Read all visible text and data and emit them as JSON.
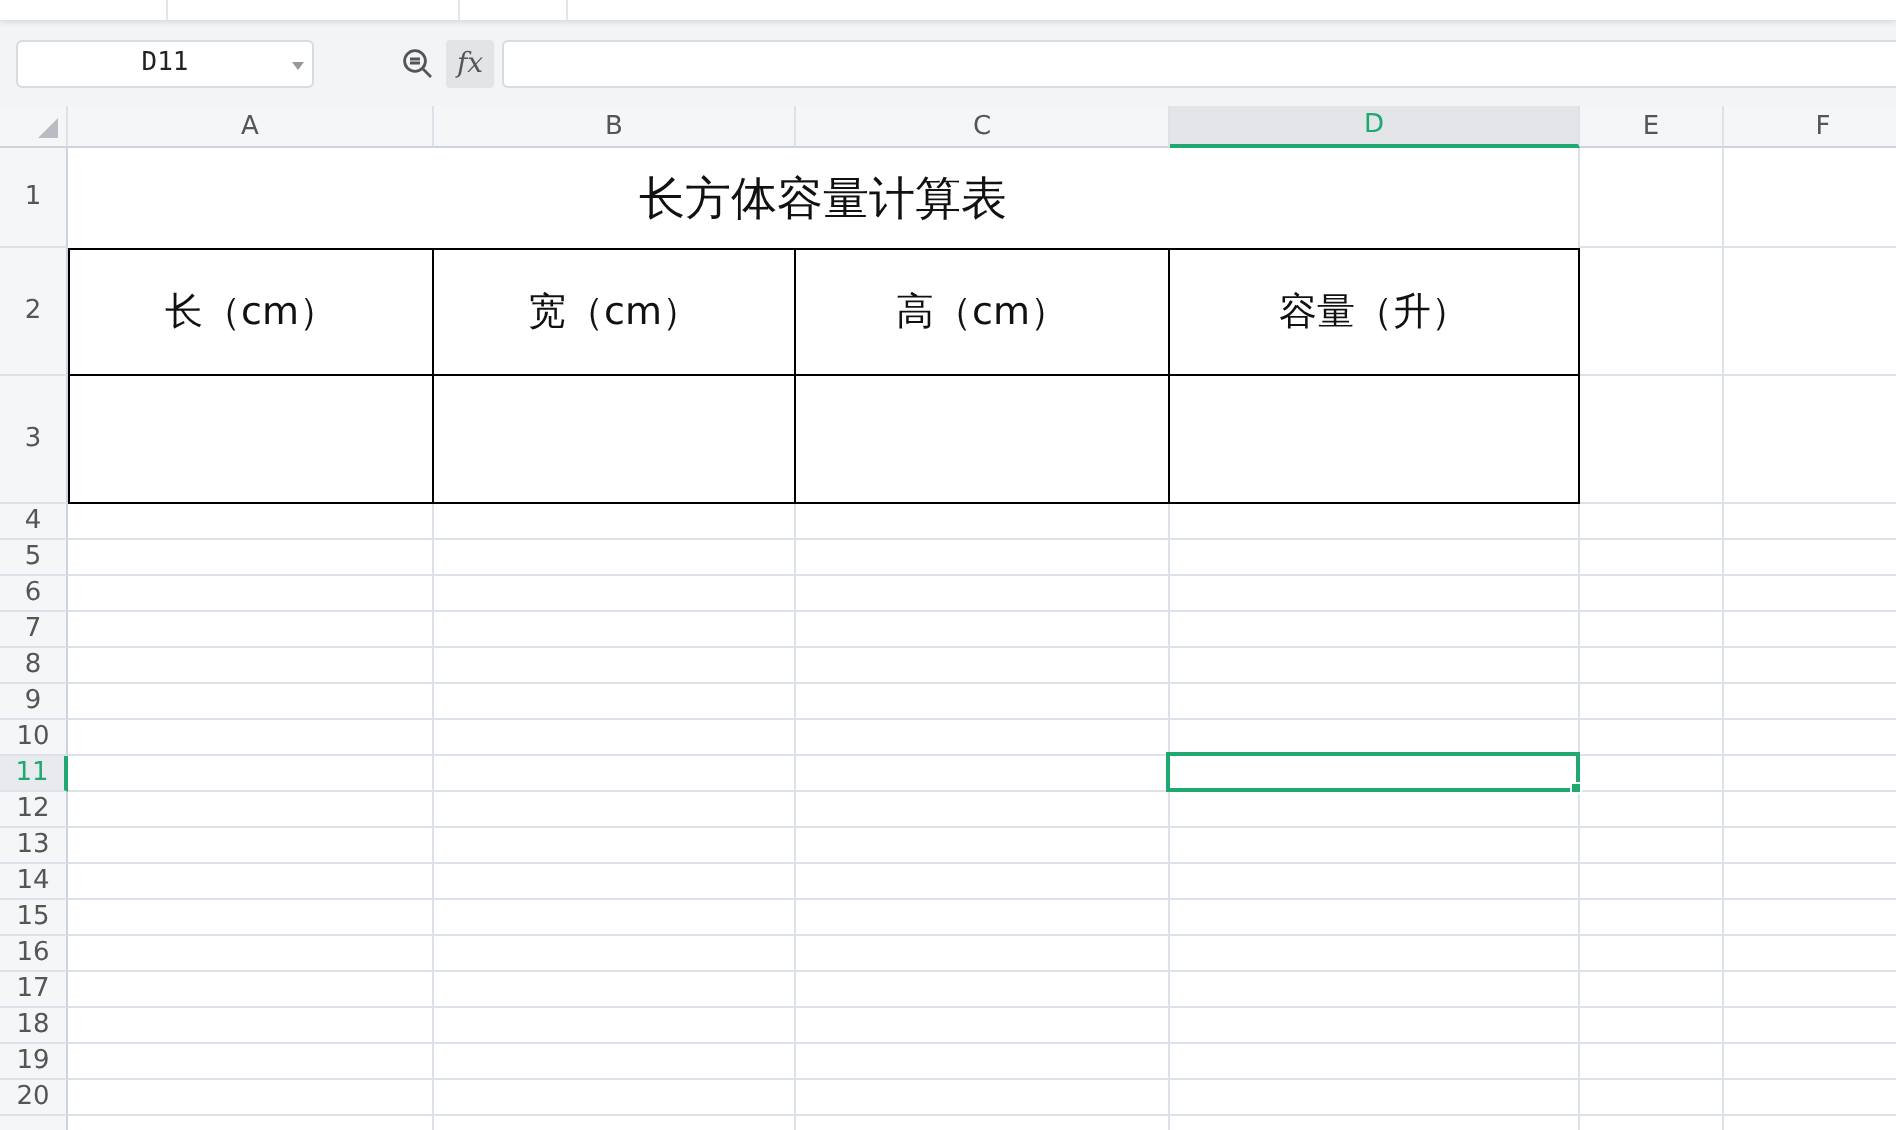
{
  "name_box": {
    "value": "D11"
  },
  "formula_bar": {
    "function_label": "fx"
  },
  "columns": [
    {
      "label": "A",
      "selected": false
    },
    {
      "label": "B",
      "selected": false
    },
    {
      "label": "C",
      "selected": false
    },
    {
      "label": "D",
      "selected": true
    },
    {
      "label": "E",
      "selected": false
    },
    {
      "label": "F",
      "selected": false
    }
  ],
  "rows": [
    {
      "label": "1",
      "selected": false
    },
    {
      "label": "2",
      "selected": false
    },
    {
      "label": "3",
      "selected": false
    },
    {
      "label": "4",
      "selected": false
    },
    {
      "label": "5",
      "selected": false
    },
    {
      "label": "6",
      "selected": false
    },
    {
      "label": "7",
      "selected": false
    },
    {
      "label": "8",
      "selected": false
    },
    {
      "label": "9",
      "selected": false
    },
    {
      "label": "10",
      "selected": false
    },
    {
      "label": "11",
      "selected": true
    },
    {
      "label": "12",
      "selected": false
    },
    {
      "label": "13",
      "selected": false
    },
    {
      "label": "14",
      "selected": false
    },
    {
      "label": "15",
      "selected": false
    },
    {
      "label": "16",
      "selected": false
    },
    {
      "label": "17",
      "selected": false
    },
    {
      "label": "18",
      "selected": false
    },
    {
      "label": "19",
      "selected": false
    },
    {
      "label": "20",
      "selected": false
    }
  ],
  "sheet": {
    "title": "长方体容量计算表",
    "headers": [
      "长（cm）",
      "宽（cm）",
      "高（cm）",
      "容量（升）"
    ]
  }
}
